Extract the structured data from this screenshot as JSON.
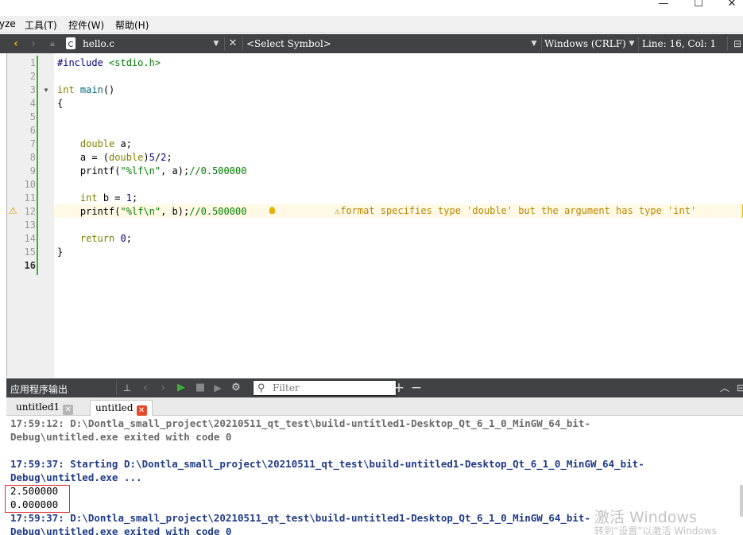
{
  "menubar": {
    "items": [
      {
        "label": "yze"
      },
      {
        "label": "工具(T)"
      },
      {
        "label": "控件(W)"
      },
      {
        "label": "帮助(H)"
      }
    ]
  },
  "window_controls": {
    "minimize": "—",
    "maximize": "☐",
    "close": "✕"
  },
  "editor_toolbar": {
    "file_name": "hello.c",
    "symbol": "<Select Symbol>",
    "line_ending": "Windows (CRLF)",
    "position": "Line: 16, Col: 1"
  },
  "editor": {
    "line_numbers": [
      "1",
      "2",
      "3",
      "4",
      "5",
      "6",
      "7",
      "8",
      "9",
      "10",
      "11",
      "12",
      "13",
      "14",
      "15",
      "16"
    ],
    "current_line": "16",
    "warning_line": "12",
    "warning_message": "format specifies type 'double' but the argument has type 'int'",
    "lines": [
      {
        "tokens": [
          {
            "t": "#include ",
            "c": "pp"
          },
          {
            "t": "<stdio.h>",
            "c": "str"
          }
        ]
      },
      {
        "tokens": []
      },
      {
        "tokens": [
          {
            "t": "int",
            "c": "kw"
          },
          {
            "t": " "
          },
          {
            "t": "main",
            "c": "fn"
          },
          {
            "t": "()"
          }
        ]
      },
      {
        "tokens": [
          {
            "t": "{"
          }
        ]
      },
      {
        "tokens": []
      },
      {
        "tokens": []
      },
      {
        "tokens": [
          {
            "t": "    "
          },
          {
            "t": "double",
            "c": "kw"
          },
          {
            "t": " a;"
          }
        ]
      },
      {
        "tokens": [
          {
            "t": "    a = ("
          },
          {
            "t": "double",
            "c": "kw"
          },
          {
            "t": ")"
          },
          {
            "t": "5",
            "c": "num"
          },
          {
            "t": "/"
          },
          {
            "t": "2",
            "c": "num"
          },
          {
            "t": ";"
          }
        ]
      },
      {
        "tokens": [
          {
            "t": "    printf("
          },
          {
            "t": "\"%lf\\n\"",
            "c": "str"
          },
          {
            "t": ", a);"
          },
          {
            "t": "//0.500000",
            "c": "cmt"
          }
        ]
      },
      {
        "tokens": []
      },
      {
        "tokens": [
          {
            "t": "    "
          },
          {
            "t": "int",
            "c": "kw"
          },
          {
            "t": " b = "
          },
          {
            "t": "1",
            "c": "num"
          },
          {
            "t": ";"
          }
        ]
      },
      {
        "tokens": [
          {
            "t": "    printf("
          },
          {
            "t": "\"%lf\\n\"",
            "c": "str"
          },
          {
            "t": ", b);"
          },
          {
            "t": "//0.500000",
            "c": "cmt"
          }
        ]
      },
      {
        "tokens": []
      },
      {
        "tokens": [
          {
            "t": "    "
          },
          {
            "t": "return",
            "c": "kw"
          },
          {
            "t": " "
          },
          {
            "t": "0",
            "c": "num"
          },
          {
            "t": ";"
          }
        ]
      },
      {
        "tokens": [
          {
            "t": "}"
          }
        ]
      },
      {
        "tokens": []
      }
    ]
  },
  "output_pane": {
    "title": "应用程序输出",
    "filter_placeholder": "Filter",
    "tabs": [
      {
        "label": "untitled1"
      },
      {
        "label": "untitled"
      }
    ],
    "lines": [
      {
        "text": "17:59:12: D:\\Dontla_small_project\\20210511_qt_test\\build-untitled1-Desktop_Qt_6_1_0_MinGW_64_bit-",
        "c": "gray"
      },
      {
        "text": "Debug\\untitled.exe exited with code 0",
        "c": "gray"
      },
      {
        "text": "",
        "c": "plain"
      },
      {
        "text": "17:59:37: Starting D:\\Dontla_small_project\\20210511_qt_test\\build-untitled1-Desktop_Qt_6_1_0_MinGW_64_bit-",
        "c": "blue"
      },
      {
        "text": "Debug\\untitled.exe ...",
        "c": "blue"
      },
      {
        "text": "2.500000",
        "c": "plain"
      },
      {
        "text": "0.000000",
        "c": "plain"
      },
      {
        "text": "17:59:37: D:\\Dontla_small_project\\20210511_qt_test\\build-untitled1-Desktop_Qt_6_1_0_MinGW_64_bit-",
        "c": "blue"
      },
      {
        "text": "Debug\\untitled.exe exited with code 0",
        "c": "blue"
      }
    ]
  },
  "watermark": {
    "line1": "激活 Windows",
    "line2": "转到“设置”以激活 Windows"
  },
  "colors": {
    "toolbar_bg": "#404244",
    "gutter_green": "#3cb03c",
    "warning": "#b88700",
    "output_blue": "#1f3c8a",
    "highlight_red": "#e03030"
  }
}
